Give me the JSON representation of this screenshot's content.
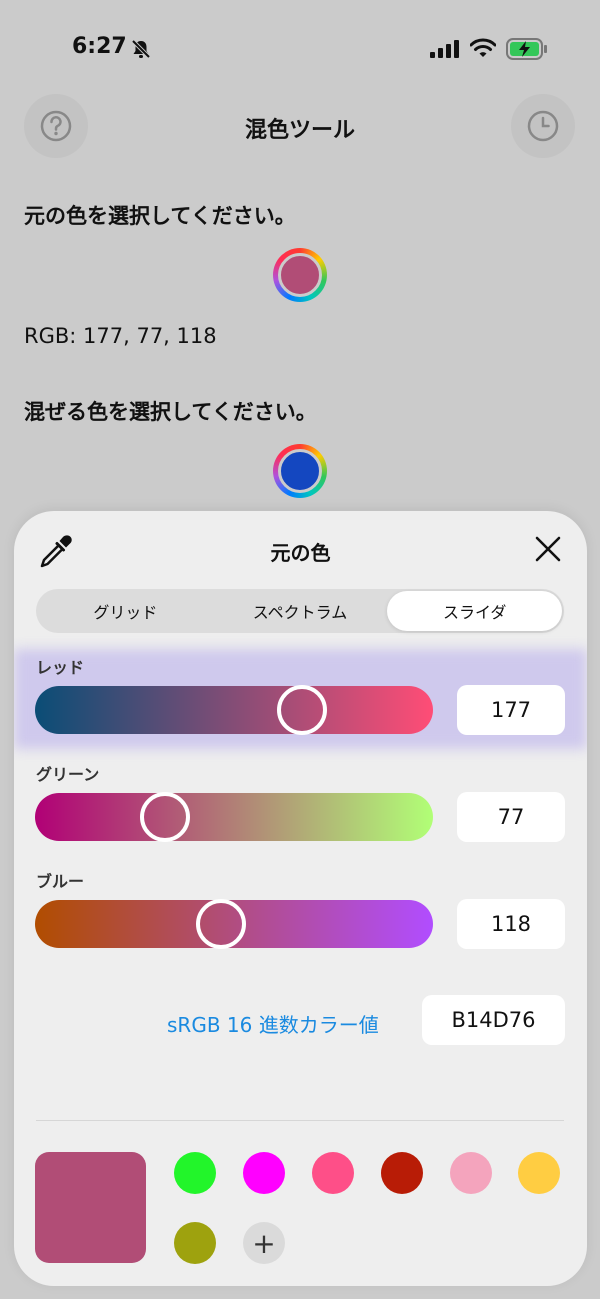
{
  "status": {
    "time": "6:27"
  },
  "nav": {
    "title": "混色ツール"
  },
  "main": {
    "original_label": "元の色を選択してください。",
    "original_color": "#b14d76",
    "rgb_text": "RGB: 177, 77, 118",
    "mix_label": "混ぜる色を選択してください。",
    "mix_color": "#1447c0"
  },
  "sheet": {
    "title": "元の色",
    "tabs": [
      {
        "label": "グリッド",
        "active": false
      },
      {
        "label": "スペクトラム",
        "active": false
      },
      {
        "label": "スライダ",
        "active": true
      }
    ],
    "sliders": [
      {
        "label": "レッド",
        "value": "177",
        "fraction": 0.694
      },
      {
        "label": "グリーン",
        "value": "77",
        "fraction": 0.302
      },
      {
        "label": "ブルー",
        "value": "118",
        "fraction": 0.463
      }
    ],
    "hex_label": "sRGB 16 進数カラー値",
    "hex_value": "B14D76",
    "current_color": "#b14d76",
    "swatches": [
      "#22f52a",
      "#ff00ff",
      "#fe4f88",
      "#b81c06",
      "#f4a4bd",
      "#ffcd42",
      "#9ea20e"
    ],
    "add_label": "+"
  }
}
